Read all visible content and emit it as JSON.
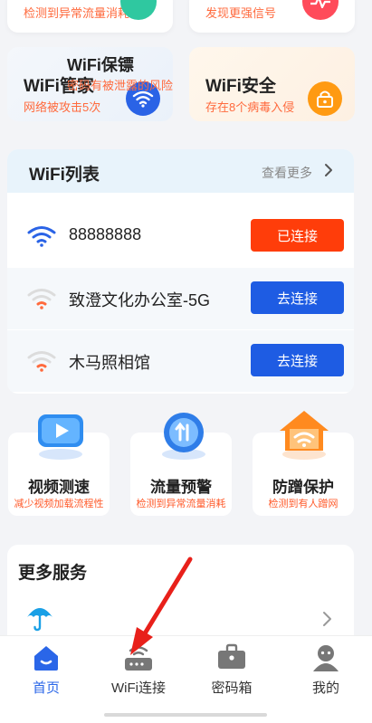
{
  "top_cards": [
    {
      "subtitle": "检测到异常流量消耗"
    },
    {
      "subtitle": "发现更强信号"
    }
  ],
  "feature_cards": [
    {
      "title": "WiFi管家",
      "subtitle": "网络被攻击5次",
      "icon": "wifi-icon"
    },
    {
      "title": "WiFi安全",
      "subtitle": "存在8个病毒入侵",
      "icon": "router-lock-icon"
    }
  ],
  "wifi_list": {
    "title": "WiFi列表",
    "more": "查看更多",
    "networks": [
      {
        "name": "88888888",
        "action": "已连接",
        "status": "connected",
        "signal": "strong"
      },
      {
        "name": "致澄文化办公室-5G",
        "action": "去连接",
        "status": "available",
        "signal": "weak"
      },
      {
        "name": "木马照相馆",
        "action": "去连接",
        "status": "available",
        "signal": "weak"
      }
    ]
  },
  "tools": [
    {
      "name": "视频测速",
      "desc": "减少视频加载流程性",
      "icon": "video-icon"
    },
    {
      "name": "流量预警",
      "desc": "检测到异常流量消耗",
      "icon": "traffic-icon"
    },
    {
      "name": "防蹭保护",
      "desc": "检测到有人蹭网",
      "icon": "house-wifi-icon"
    }
  ],
  "more_services": {
    "title": "更多服务",
    "items": [
      {
        "title": "WiFi保镖",
        "subtitle": "密码有被泄露的风险",
        "icon": "umbrella-icon"
      }
    ]
  },
  "bottom_nav": [
    {
      "label": "首页",
      "icon": "home-icon",
      "active": true
    },
    {
      "label": "WiFi连接",
      "icon": "router-icon",
      "active": false
    },
    {
      "label": "密码箱",
      "icon": "briefcase-icon",
      "active": false
    },
    {
      "label": "我的",
      "icon": "user-icon",
      "active": false
    }
  ],
  "colors": {
    "accent_blue": "#1e5ce3",
    "connected_red": "#ff3d0a",
    "warning_orange": "#ff6a3d",
    "annotation_red": "#e8201a"
  }
}
